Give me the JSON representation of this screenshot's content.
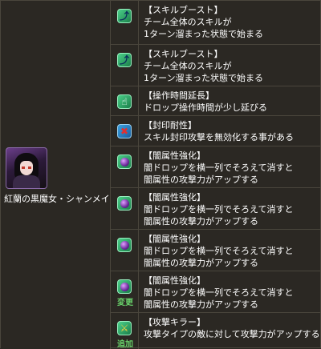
{
  "character": {
    "name": "紅蘭の黒魔女・シャンメイ"
  },
  "awakenings": [
    {
      "icon": "skill-boost-icon",
      "title": "【スキルブースト】",
      "lines": [
        "チーム全体のスキルが",
        "1ターン溜まった状態で始まる"
      ],
      "tag": ""
    },
    {
      "icon": "skill-boost-icon",
      "title": "【スキルブースト】",
      "lines": [
        "チーム全体のスキルが",
        "1ターン溜まった状態で始まる"
      ],
      "tag": ""
    },
    {
      "icon": "extend-time-icon",
      "title": "【操作時間延長】",
      "lines": [
        "ドロップ操作時間が少し延びる"
      ],
      "tag": ""
    },
    {
      "icon": "seal-resist-icon",
      "title": "【封印耐性】",
      "lines": [
        "スキル封印攻撃を無効化する事がある"
      ],
      "tag": ""
    },
    {
      "icon": "dark-row-icon",
      "title": "【闇属性強化】",
      "lines": [
        "闇ドロップを横一列でそろえて消すと",
        "闇属性の攻撃力がアップする"
      ],
      "tag": ""
    },
    {
      "icon": "dark-row-icon",
      "title": "【闇属性強化】",
      "lines": [
        "闇ドロップを横一列でそろえて消すと",
        "闇属性の攻撃力がアップする"
      ],
      "tag": ""
    },
    {
      "icon": "dark-row-icon",
      "title": "【闇属性強化】",
      "lines": [
        "闇ドロップを横一列でそろえて消すと",
        "闇属性の攻撃力がアップする"
      ],
      "tag": ""
    },
    {
      "icon": "dark-row-icon",
      "title": "【闇属性強化】",
      "lines": [
        "闇ドロップを横一列でそろえて消すと",
        "闇属性の攻撃力がアップする"
      ],
      "tag": "変更"
    },
    {
      "icon": "attack-killer-icon",
      "title": "【攻撃キラー】",
      "lines": [
        "攻撃タイプの敵に対して攻撃力がアップする"
      ],
      "tag": "追加"
    }
  ],
  "colors": {
    "background": "#2b2823",
    "border": "#4a463c",
    "tag": "#69d26b"
  }
}
